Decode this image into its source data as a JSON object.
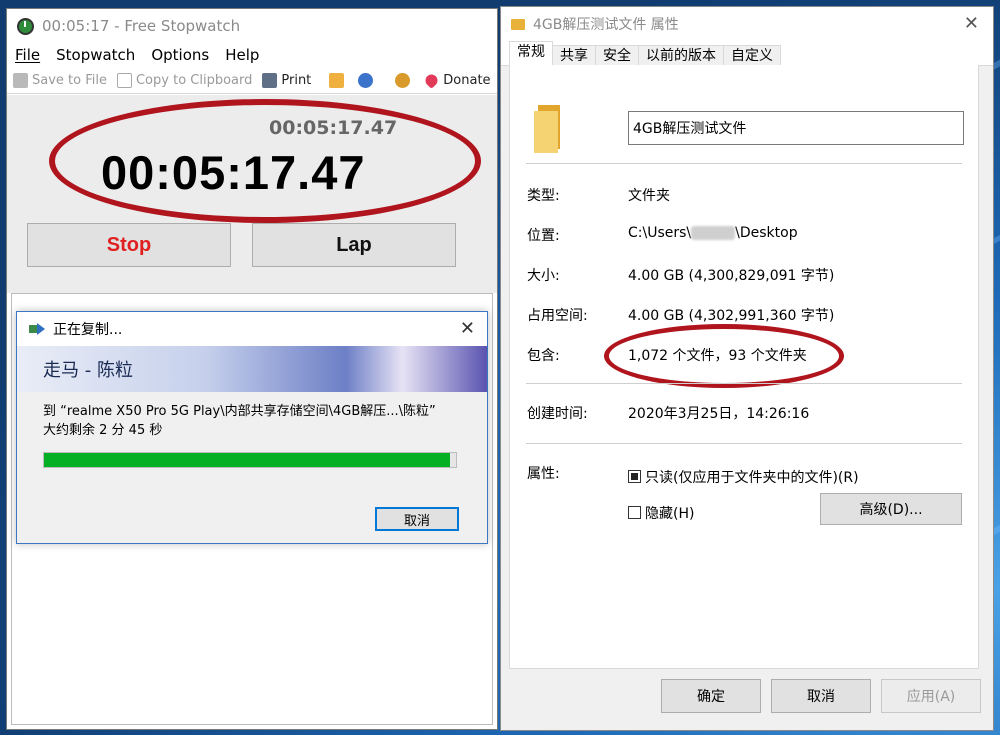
{
  "stopwatch": {
    "title": "00:05:17 - Free Stopwatch",
    "menu": [
      "File",
      "Stopwatch",
      "Options",
      "Help"
    ],
    "toolbar": {
      "save": "Save to File",
      "copy": "Copy to Clipboard",
      "print": "Print",
      "donate": "Donate"
    },
    "small_time": "00:05:17.47",
    "big_time": "00:05:17.47",
    "stop_label": "Stop",
    "lap_label": "Lap"
  },
  "copy_dialog": {
    "title": "正在复制...",
    "close": "✕",
    "banner": "走马 - 陈粒",
    "line1": "到 “realme X50 Pro 5G Play\\内部共享存储空间\\4GB解压...\\陈粒”",
    "line2": "大约剩余 2 分 45 秒",
    "progress": 0.985,
    "cancel": "取消"
  },
  "properties": {
    "title": "4GB解压测试文件 属性",
    "close": "✕",
    "tabs": [
      "常规",
      "共享",
      "安全",
      "以前的版本",
      "自定义"
    ],
    "name": "4GB解压测试文件",
    "type_label": "类型:",
    "type_value": "文件夹",
    "location_label": "位置:",
    "location_prefix": "C:\\Users\\",
    "location_suffix": "\\Desktop",
    "size_label": "大小:",
    "size_value": "4.00 GB (4,300,829,091 字节)",
    "disk_label": "占用空间:",
    "disk_value": "4.00 GB (4,302,991,360 字节)",
    "contains_label": "包含:",
    "contains_value": "1,072 个文件，93 个文件夹",
    "created_label": "创建时间:",
    "created_value": "2020年3月25日，14:26:16",
    "attr_label": "属性:",
    "readonly": "只读(仅应用于文件夹中的文件)(R)",
    "hidden": "隐藏(H)",
    "advanced": "高级(D)...",
    "ok": "确定",
    "cancel": "取消",
    "apply": "应用(A)"
  },
  "colors": {
    "annotation": "#b0141d",
    "stop": "#e02020",
    "progress": "#06b025"
  }
}
